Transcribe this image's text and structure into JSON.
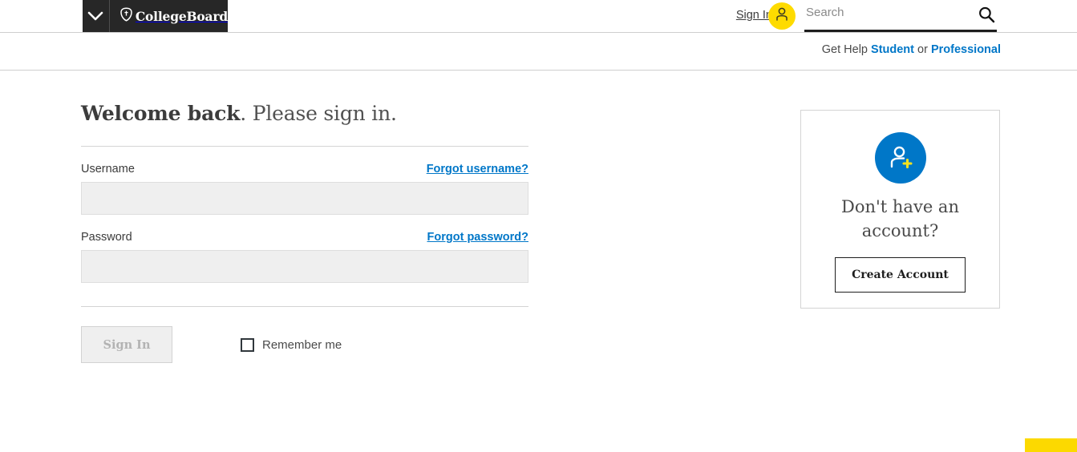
{
  "header": {
    "menu_icon": "chevron-down-icon",
    "brand": "CollegeBoard",
    "brand_icon": "acorn-icon",
    "signin_label": "Sign In",
    "avatar_icon": "person-icon",
    "search_placeholder": "Search",
    "search_value": "",
    "search_icon": "search-icon"
  },
  "help_bar": {
    "prefix": "Get Help",
    "student_link": "Student",
    "separator": "or",
    "professional_link": "Professional"
  },
  "form": {
    "heading_bold": "Welcome back",
    "heading_rest": ". Please sign in.",
    "username": {
      "label": "Username",
      "forgot_link": "Forgot username?",
      "value": "",
      "placeholder": ""
    },
    "password": {
      "label": "Password",
      "forgot_link": "Forgot password?",
      "value": "",
      "placeholder": ""
    },
    "submit_label": "Sign In",
    "remember_label": "Remember me",
    "remember_checked": false
  },
  "signup_card": {
    "icon": "add-user-icon",
    "title": "Don't have an account?",
    "button_label": "Create Account"
  },
  "colors": {
    "brand_blue": "#0077c8",
    "brand_yellow": "#fedb00",
    "tab_yellow": "#fcd900",
    "header_black": "#272727",
    "input_gray": "#efefef"
  }
}
